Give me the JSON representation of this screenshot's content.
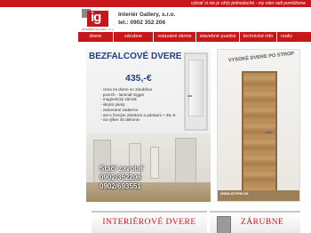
{
  "header": {
    "tagline": "vybrať si nie je vždy jednoduché - my vám radi pomôžeme",
    "logo_glyph": "ig",
    "logo_sub": "INTERIÉR GALLERY, s.r.o.",
    "company": "Interiér Gallery, s.r.o.",
    "phone": "tel.: 0902 352 206"
  },
  "nav": {
    "items": [
      {
        "label": "dvere"
      },
      {
        "label": "zárubne"
      },
      {
        "label": "vstavané skrine"
      },
      {
        "label": "stavebné puzdrá"
      },
      {
        "label": "technické info"
      },
      {
        "label": "realiz"
      }
    ]
  },
  "promo": {
    "title": "BEZFALCOVÉ DVERE",
    "price": "435,-€",
    "features": [
      "cena za dvere so zárubňou",
      "povrch - lamináť Egger",
      "magnetický zámok",
      "skryté pánty",
      "zamerané zadarmo",
      "set s čemým zámkom a pántami + 38,-€",
      "na výber 40 dekorov"
    ],
    "call": "Stačí zavolať",
    "phone1": "0902/352206",
    "phone2": "0902/693551"
  },
  "ad": {
    "title": "VYSOKÉ DVERE PO STROP",
    "url": "WWW.ATYPIK.SK"
  },
  "tiles": [
    {
      "label": "INTERIÉROVÉ DVERE"
    },
    {
      "label": "ZÁRUBNE"
    }
  ],
  "colors": {
    "brand_red": "#c8161d",
    "promo_blue": "#1c3f8c"
  }
}
